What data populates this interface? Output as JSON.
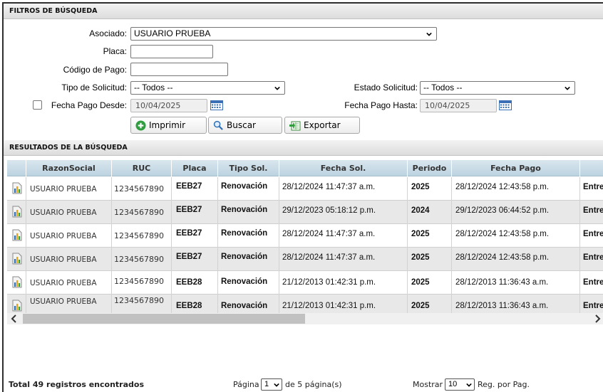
{
  "filters": {
    "header": "FILTROS DE BÚSQUEDA",
    "asociado_label": "Asociado:",
    "asociado_value": "USUARIO PRUEBA",
    "placa_label": "Placa:",
    "placa_value": "",
    "codigo_label": "Código de Pago:",
    "codigo_value": "",
    "tipo_label": "Tipo de Solicitud:",
    "tipo_value": "-- Todos --",
    "estado_label": "Estado Solicitud:",
    "estado_value": "-- Todos --",
    "fecha_desde_label": "Fecha Pago Desde:",
    "fecha_desde_value": "10/04/2025",
    "fecha_desde_checked": false,
    "fecha_hasta_label": "Fecha Pago Hasta:",
    "fecha_hasta_value": "10/04/2025"
  },
  "actions": {
    "imprimir": "Imprimir",
    "buscar": "Buscar",
    "exportar": "Exportar"
  },
  "results": {
    "header": "RESULTADOS DE LA BÚSQUEDA",
    "columns": [
      "RazonSocial",
      "RUC",
      "Placa",
      "Tipo Sol.",
      "Fecha Sol.",
      "Periodo",
      "Fecha Pago",
      "Es"
    ],
    "rows": [
      {
        "razon": "USUARIO PRUEBA",
        "ruc": "1234567890",
        "placa": "EEB27",
        "tipo": "Renovación",
        "fecha_sol": "28/12/2024 11:47:37 a.m.",
        "periodo": "2025",
        "fecha_pago": "28/12/2024 12:43:58 p.m.",
        "estado": "Entre"
      },
      {
        "razon": "USUARIO PRUEBA",
        "ruc": "1234567890",
        "placa": "EEB27",
        "tipo": "Renovación",
        "fecha_sol": "29/12/2023 05:18:12 p.m.",
        "periodo": "2024",
        "fecha_pago": "29/12/2023 06:44:52 p.m.",
        "estado": "Entre"
      },
      {
        "razon": "USUARIO PRUEBA",
        "ruc": "1234567890",
        "placa": "EEB27",
        "tipo": "Renovación",
        "fecha_sol": "28/12/2024 11:47:37 a.m.",
        "periodo": "2025",
        "fecha_pago": "28/12/2024 12:43:58 p.m.",
        "estado": "Entre"
      },
      {
        "razon": "USUARIO PRUEBA",
        "ruc": "1234567890",
        "placa": "EEB27",
        "tipo": "Renovación",
        "fecha_sol": "28/12/2024 11:47:37 a.m.",
        "periodo": "2025",
        "fecha_pago": "28/12/2024 12:43:58 p.m.",
        "estado": "Entre"
      },
      {
        "razon": "USUARIO PRUEBA",
        "ruc": "1234567890",
        "placa": "EEB28",
        "tipo": "Renovación",
        "fecha_sol": "21/12/2013 01:42:31 p.m.",
        "periodo": "2025",
        "fecha_pago": "28/12/2013 11:36:43 a.m.",
        "estado": "Entre"
      },
      {
        "razon": "USUARIO PRUEBA",
        "ruc": "1234567890",
        "placa": "EEB28",
        "tipo": "Renovación",
        "fecha_sol": "21/12/2013 01:42:31 p.m.",
        "periodo": "2025",
        "fecha_pago": "28/12/2013 11:36:43 a.m.",
        "estado": "Entre"
      }
    ]
  },
  "footer": {
    "total": "Total 49 registros encontrados",
    "page_label": "Página",
    "page_value": "1",
    "page_suffix": "de 5 página(s)",
    "show_label": "Mostrar",
    "show_value": "10",
    "show_suffix": "Reg. por Pag."
  },
  "colors": {
    "header_blue": "#bcd3e0",
    "row_alt": "#e8e8e8",
    "calendar_blue": "#3a6fb5",
    "imprimir_green": "#2e9e3e"
  }
}
